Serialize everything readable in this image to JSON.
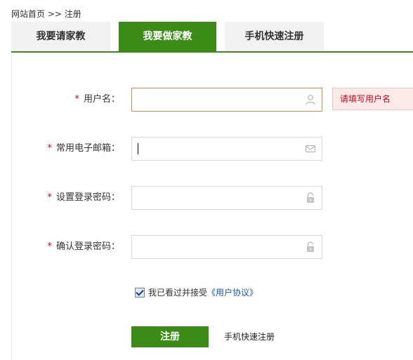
{
  "breadcrumb": {
    "home": "网站首页",
    "separator": ">>",
    "current": "注册"
  },
  "tabs": [
    {
      "label": "我要请家教",
      "active": false
    },
    {
      "label": "我要做家教",
      "active": true
    },
    {
      "label": "手机快速注册",
      "active": false
    }
  ],
  "form": {
    "required_mark": "*",
    "username": {
      "label": "用户名：",
      "value": "",
      "error": "请填写用户名",
      "icon": "user-icon"
    },
    "email": {
      "label": "常用电子邮箱：",
      "value": "",
      "icon": "mail-icon"
    },
    "password": {
      "label": "设置登录密码：",
      "value": "",
      "icon": "lock-icon"
    },
    "confirm_password": {
      "label": "确认登录密码：",
      "value": "",
      "icon": "lock-icon"
    },
    "agree": {
      "checked": true,
      "text": "我已看过并接受",
      "link": "《用户协议》"
    },
    "submit_label": "注册",
    "quick_register_label": "手机快速注册"
  },
  "colors": {
    "accent": "#3a8c16",
    "error": "#d0021b",
    "link": "#1a55a6"
  }
}
